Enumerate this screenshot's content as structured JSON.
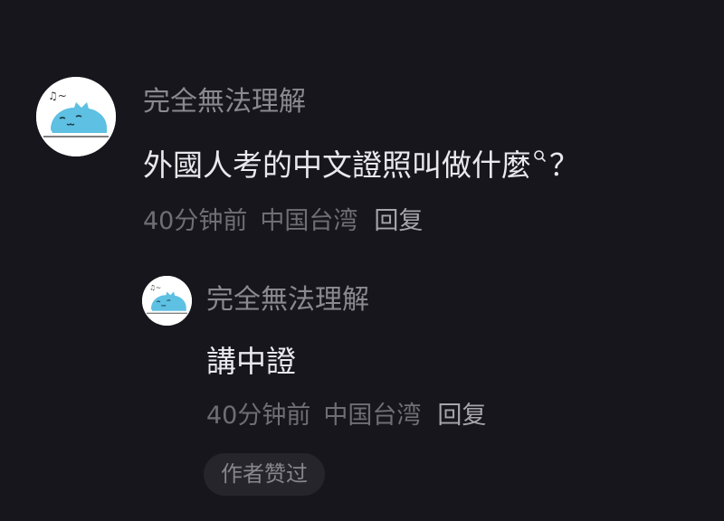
{
  "comment": {
    "username": "完全無法理解",
    "text": "外國人考的中文證照叫做什麼",
    "text_suffix": "？",
    "time": "40分钟前",
    "location": "中国台湾",
    "reply_label": "回复"
  },
  "reply": {
    "username": "完全無法理解",
    "text": "講中證",
    "time": "40分钟前",
    "location": "中国台湾",
    "reply_label": "回复",
    "author_liked_label": "作者赞过"
  },
  "icons": {
    "avatar": "blue-cat-avatar-icon",
    "search": "search-icon"
  },
  "colors": {
    "background": "#17161c",
    "username": "#8a8990",
    "text": "#e9e8ee",
    "meta": "#6f6e76",
    "reply_link": "#a6a5ac",
    "avatar_cat": "#5ec0e2",
    "badge_bg": "#26252c"
  }
}
